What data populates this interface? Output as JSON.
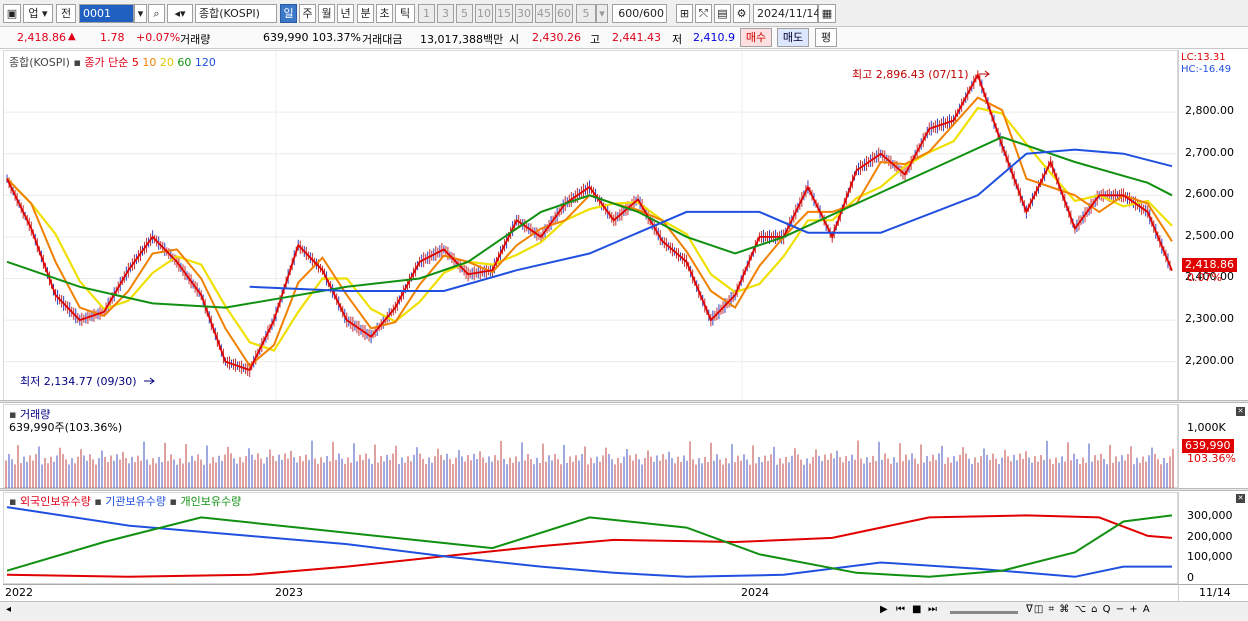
{
  "toolbar": {
    "mode": "업",
    "prev": "전",
    "code": "0001",
    "name": "종합(KOSPI)",
    "periods": [
      "일",
      "주",
      "월",
      "년",
      "분",
      "초",
      "틱"
    ],
    "active_period": "일",
    "numbers": [
      "1",
      "3",
      "5",
      "10",
      "15",
      "30",
      "45",
      "60"
    ],
    "n_value": "5",
    "count": "600",
    "count_total": "/600",
    "date": "2024/11/14"
  },
  "info": {
    "price": "2,418.86",
    "change": "1.78",
    "change_pct": "+0.07%",
    "vol_label": "거래량",
    "vol": "639,990",
    "vol_pct": "103.37%",
    "amt_label": "거래대금",
    "amt": "13,017,388백만",
    "open_label": "시",
    "open": "2,430.26",
    "high_label": "고",
    "high": "2,441.43",
    "low_label": "저",
    "low": "2,410.9",
    "buy": "매수",
    "sell": "매도",
    "eval": "평"
  },
  "colors": {
    "ma5": "#e00000",
    "ma10": "#f08000",
    "ma20": "#f0e000",
    "ma60": "#109010",
    "ma120": "#2050e0",
    "foreign": "#e00000",
    "inst": "#2050e0",
    "indiv": "#109010"
  },
  "chart_data": [
    {
      "type": "line",
      "legend_name": "종합(KOSPI)",
      "legend_ma_label": "종가 단순",
      "ma_periods": [
        "5",
        "10",
        "20",
        "60",
        "120"
      ],
      "lc_label": "LC:13.31",
      "hc_label": "HC:-16.49",
      "y_ticks": [
        "2,800.00",
        "2,700.00",
        "2,600.00",
        "2,500.00",
        "2,400.00",
        "2,300.00",
        "2,200.00"
      ],
      "y_tick_values": [
        2800,
        2700,
        2600,
        2500,
        2400,
        2300,
        2200
      ],
      "ylim": [
        2115,
        2935
      ],
      "last_price": "2,418.86",
      "last_pct": "0.07%",
      "max_label": "최고 2,896.43 (07/11)",
      "min_label": "최저 2,134.77 (09/30)",
      "x_labels": [
        "2022",
        "2023",
        "2024",
        "11/14"
      ],
      "close": [
        {
          "d": "2022-05",
          "v": 2640
        },
        {
          "d": "2022-06",
          "v": 2520
        },
        {
          "d": "2022-07",
          "v": 2360
        },
        {
          "d": "2022-08",
          "v": 2300
        },
        {
          "d": "2022-09",
          "v": 2320
        },
        {
          "d": "2022-10",
          "v": 2420
        },
        {
          "d": "2022-11",
          "v": 2500
        },
        {
          "d": "2022-12",
          "v": 2440
        },
        {
          "d": "2023-01",
          "v": 2360
        },
        {
          "d": "2023-02",
          "v": 2200
        },
        {
          "d": "2023-03",
          "v": 2180
        },
        {
          "d": "2023-04",
          "v": 2300
        },
        {
          "d": "2023-05",
          "v": 2480
        },
        {
          "d": "2023-06",
          "v": 2420
        },
        {
          "d": "2023-07",
          "v": 2300
        },
        {
          "d": "2023-08",
          "v": 2260
        },
        {
          "d": "2023-09",
          "v": 2330
        },
        {
          "d": "2023-10",
          "v": 2440
        },
        {
          "d": "2023-11",
          "v": 2470
        },
        {
          "d": "2023-12",
          "v": 2410
        },
        {
          "d": "2024-01",
          "v": 2420
        },
        {
          "d": "2024-02",
          "v": 2540
        },
        {
          "d": "2024-03",
          "v": 2500
        },
        {
          "d": "2024-04",
          "v": 2580
        },
        {
          "d": "2024-05",
          "v": 2620
        },
        {
          "d": "2024-06",
          "v": 2540
        },
        {
          "d": "2024-07",
          "v": 2590
        },
        {
          "d": "2024-08",
          "v": 2490
        },
        {
          "d": "2024-09",
          "v": 2440
        },
        {
          "d": "2024-10",
          "v": 2300
        },
        {
          "d": "2024-11",
          "v": 2360
        },
        {
          "d": "2024-12",
          "v": 2500
        },
        {
          "d": "2025-01",
          "v": 2500
        },
        {
          "d": "2025-02",
          "v": 2620
        },
        {
          "d": "2025-03",
          "v": 2500
        },
        {
          "d": "2025-04",
          "v": 2660
        },
        {
          "d": "2025-05",
          "v": 2700
        },
        {
          "d": "2025-06",
          "v": 2650
        },
        {
          "d": "2025-07",
          "v": 2760
        },
        {
          "d": "2025-08",
          "v": 2780
        },
        {
          "d": "2025-09",
          "v": 2890
        },
        {
          "d": "2025-10",
          "v": 2720
        },
        {
          "d": "2025-11",
          "v": 2560
        },
        {
          "d": "2025-12",
          "v": 2680
        },
        {
          "d": "2026-01",
          "v": 2520
        },
        {
          "d": "2026-02",
          "v": 2600
        },
        {
          "d": "2026-03",
          "v": 2600
        },
        {
          "d": "2026-04",
          "v": 2560
        },
        {
          "d": "2026-05",
          "v": 2419
        }
      ],
      "ma120": [
        {
          "i": 10,
          "v": 2380
        },
        {
          "i": 14,
          "v": 2370
        },
        {
          "i": 18,
          "v": 2370
        },
        {
          "i": 21,
          "v": 2420
        },
        {
          "i": 24,
          "v": 2460
        },
        {
          "i": 28,
          "v": 2560
        },
        {
          "i": 31,
          "v": 2560
        },
        {
          "i": 33,
          "v": 2510
        },
        {
          "i": 36,
          "v": 2510
        },
        {
          "i": 40,
          "v": 2600
        },
        {
          "i": 42,
          "v": 2700
        },
        {
          "i": 44,
          "v": 2710
        },
        {
          "i": 46,
          "v": 2700
        },
        {
          "i": 48,
          "v": 2670
        }
      ],
      "ma60": [
        {
          "i": 0,
          "v": 2440
        },
        {
          "i": 3,
          "v": 2380
        },
        {
          "i": 6,
          "v": 2340
        },
        {
          "i": 9,
          "v": 2330
        },
        {
          "i": 11,
          "v": 2350
        },
        {
          "i": 14,
          "v": 2380
        },
        {
          "i": 17,
          "v": 2400
        },
        {
          "i": 19,
          "v": 2440
        },
        {
          "i": 22,
          "v": 2560
        },
        {
          "i": 24,
          "v": 2600
        },
        {
          "i": 26,
          "v": 2560
        },
        {
          "i": 28,
          "v": 2500
        },
        {
          "i": 30,
          "v": 2460
        },
        {
          "i": 32,
          "v": 2500
        },
        {
          "i": 35,
          "v": 2580
        },
        {
          "i": 38,
          "v": 2660
        },
        {
          "i": 41,
          "v": 2740
        },
        {
          "i": 44,
          "v": 2680
        },
        {
          "i": 47,
          "v": 2630
        },
        {
          "i": 48,
          "v": 2600
        }
      ]
    },
    {
      "type": "bar",
      "legend_name": "거래량",
      "summary": "639,990주(103.36%)",
      "y_ticks": [
        "1,000K"
      ],
      "y_tick_values": [
        1000
      ],
      "ylim": [
        0,
        1200
      ],
      "last_value": "639,990",
      "last_pct": "103.36%"
    },
    {
      "type": "line",
      "series_names": [
        "외국인보유수량",
        "기관보유수량",
        "개인보유수량"
      ],
      "y_ticks": [
        "300,000",
        "200,000",
        "100,000",
        "0"
      ],
      "y_tick_values": [
        300000,
        200000,
        100000,
        0
      ],
      "ylim": [
        -20000,
        380000
      ],
      "foreign": [
        {
          "i": 0,
          "v": 20000
        },
        {
          "i": 5,
          "v": 10000
        },
        {
          "i": 10,
          "v": 20000
        },
        {
          "i": 14,
          "v": 60000
        },
        {
          "i": 18,
          "v": 110000
        },
        {
          "i": 22,
          "v": 160000
        },
        {
          "i": 25,
          "v": 190000
        },
        {
          "i": 30,
          "v": 180000
        },
        {
          "i": 34,
          "v": 200000
        },
        {
          "i": 38,
          "v": 300000
        },
        {
          "i": 42,
          "v": 310000
        },
        {
          "i": 45,
          "v": 300000
        },
        {
          "i": 47,
          "v": 210000
        },
        {
          "i": 48,
          "v": 200000
        }
      ],
      "inst": [
        {
          "i": 0,
          "v": 350000
        },
        {
          "i": 5,
          "v": 260000
        },
        {
          "i": 10,
          "v": 210000
        },
        {
          "i": 14,
          "v": 170000
        },
        {
          "i": 18,
          "v": 110000
        },
        {
          "i": 22,
          "v": 60000
        },
        {
          "i": 25,
          "v": 30000
        },
        {
          "i": 28,
          "v": 10000
        },
        {
          "i": 32,
          "v": 20000
        },
        {
          "i": 36,
          "v": 80000
        },
        {
          "i": 40,
          "v": 50000
        },
        {
          "i": 44,
          "v": 10000
        },
        {
          "i": 46,
          "v": 60000
        },
        {
          "i": 48,
          "v": 60000
        }
      ],
      "indiv": [
        {
          "i": 0,
          "v": 40000
        },
        {
          "i": 4,
          "v": 180000
        },
        {
          "i": 8,
          "v": 300000
        },
        {
          "i": 12,
          "v": 250000
        },
        {
          "i": 16,
          "v": 200000
        },
        {
          "i": 20,
          "v": 150000
        },
        {
          "i": 24,
          "v": 300000
        },
        {
          "i": 28,
          "v": 250000
        },
        {
          "i": 31,
          "v": 120000
        },
        {
          "i": 35,
          "v": 30000
        },
        {
          "i": 38,
          "v": 10000
        },
        {
          "i": 41,
          "v": 40000
        },
        {
          "i": 44,
          "v": 130000
        },
        {
          "i": 46,
          "v": 280000
        },
        {
          "i": 48,
          "v": 310000
        }
      ]
    }
  ],
  "bottom": {
    "icons": [
      "▶",
      "⏮",
      "■",
      "⏭"
    ],
    "tools": "ᐁ◫ ⌗ ⌘ ⌥ ⌂ Q − + A"
  }
}
